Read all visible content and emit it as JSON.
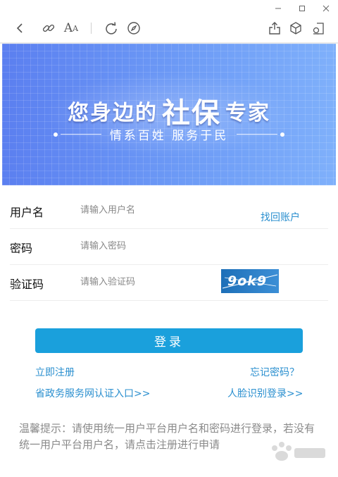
{
  "window": {
    "controls": [
      "minimize-icon",
      "maximize-icon",
      "close-icon"
    ]
  },
  "toolbar": {
    "icons": [
      "back-icon",
      "link-icon",
      "font-size-icon",
      "refresh-icon",
      "compass-icon",
      "share-icon",
      "cube-icon",
      "exit-icon"
    ]
  },
  "banner": {
    "slogan_prefix": "您身边的",
    "slogan_main": "社保",
    "slogan_suffix": "专家",
    "subtitle": "情系百姓  服务于民"
  },
  "form": {
    "username_label": "用户名",
    "username_placeholder": "请输入用户名",
    "username_value": "",
    "find_account_link": "找回账户",
    "password_label": "密码",
    "password_placeholder": "请输入密码",
    "password_value": "",
    "captcha_label": "验证码",
    "captcha_placeholder": "请输入验证码",
    "captcha_value": "",
    "captcha_image_text": "9ok9",
    "login_button": "登录"
  },
  "links": {
    "register": "立即注册",
    "forgot_password": "忘记密码？",
    "gov_entry": "省政务服务网认证入口>>",
    "face_login": "人脸识别登录>>"
  },
  "tip": "温馨提示：请使用统一用户平台用户名和密码进行登录，若没有统一用户平台用户名，请点击注册进行申请",
  "colors": {
    "accent": "#1aa0dc",
    "link": "#2a8fcf",
    "banner_start": "#5b7ff0",
    "banner_end": "#7fb0fb"
  }
}
